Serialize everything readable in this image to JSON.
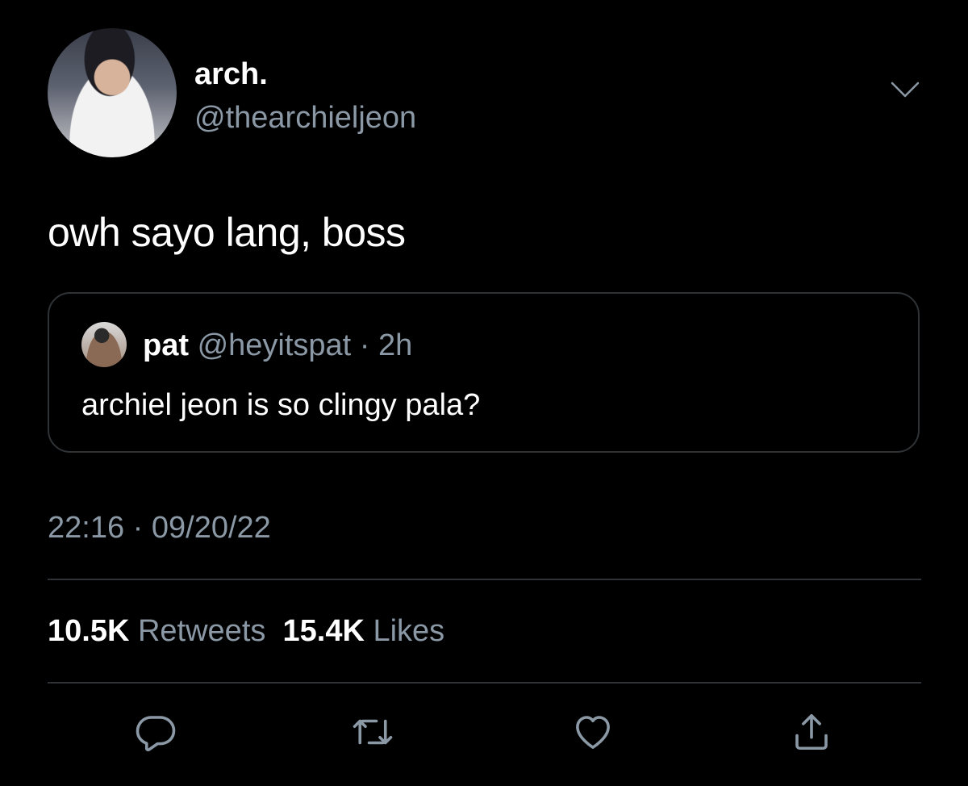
{
  "author": {
    "display_name": "arch.",
    "handle": "@thearchieljeon"
  },
  "tweet": {
    "text": "owh sayo lang, boss"
  },
  "quoted_tweet": {
    "name": "pat",
    "handle": "@heyitspat",
    "separator": " · ",
    "age": "2h",
    "text": "archiel jeon is so clingy pala?"
  },
  "meta": {
    "time": "22:16",
    "separator": " · ",
    "date": "09/20/22"
  },
  "stats": {
    "retweets_count": "10.5K",
    "retweets_label": "Retweets",
    "likes_count": "15.4K",
    "likes_label": "Likes"
  },
  "icons": {
    "menu": "chevron-down-icon",
    "reply": "reply-icon",
    "retweet": "retweet-icon",
    "like": "heart-icon",
    "share": "share-icon"
  },
  "colors": {
    "background": "#000000",
    "text_primary": "#ffffff",
    "text_secondary": "#8b98a5",
    "border": "#2f3336"
  }
}
